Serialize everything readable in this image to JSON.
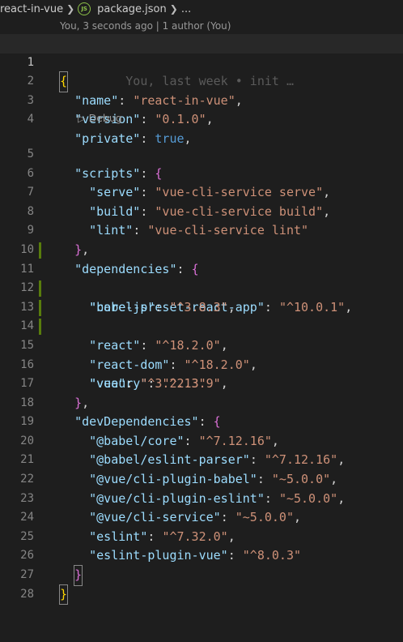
{
  "breadcrumb": {
    "folder": "react-in-vue",
    "file_icon": "JS",
    "file": "package.json",
    "more": "..."
  },
  "codelens": {
    "author": "You, 3 seconds ago | 1 author (You)",
    "debug": "Debug"
  },
  "blame_inline": "You, last week • init …",
  "colors": {
    "background": "#1e1e1e",
    "key": "#9cdcfe",
    "string": "#ce9178",
    "keyword": "#569cd6",
    "brace_level0": "#ffd700",
    "brace_level1": "#da70d6",
    "added_line_marker": "#587c0c"
  },
  "lines": [
    {
      "n": "1"
    },
    {
      "n": "2"
    },
    {
      "n": "3"
    },
    {
      "n": "4"
    },
    {
      "n": "5"
    },
    {
      "n": "6"
    },
    {
      "n": "7"
    },
    {
      "n": "8"
    },
    {
      "n": "9"
    },
    {
      "n": "10"
    },
    {
      "n": "11"
    },
    {
      "n": "12"
    },
    {
      "n": "13"
    },
    {
      "n": "14"
    },
    {
      "n": "15"
    },
    {
      "n": "16"
    },
    {
      "n": "17"
    },
    {
      "n": "18"
    },
    {
      "n": "19"
    },
    {
      "n": "20"
    },
    {
      "n": "21"
    },
    {
      "n": "22"
    },
    {
      "n": "23"
    },
    {
      "n": "24"
    },
    {
      "n": "25"
    },
    {
      "n": "26"
    },
    {
      "n": "27"
    },
    {
      "n": "28"
    }
  ],
  "json": {
    "name_key": "\"name\"",
    "name_val": "\"react-in-vue\"",
    "version_key": "\"version\"",
    "version_val": "\"0.1.0\"",
    "private_key": "\"private\"",
    "private_val": "true",
    "scripts_key": "\"scripts\"",
    "serve_key": "\"serve\"",
    "serve_val": "\"vue-cli-service serve\"",
    "build_key": "\"build\"",
    "build_val": "\"vue-cli-service build\"",
    "lint_key": "\"lint\"",
    "lint_val": "\"vue-cli-service lint\"",
    "deps_key": "\"dependencies\"",
    "dep1_key": "\"babel-preset-react-app\"",
    "dep1_val": "\"^10.0.1\"",
    "dep2_key": "\"core-js\"",
    "dep2_val": "\"^3.8.3\"",
    "dep3_key": "\"react\"",
    "dep3_val": "\"^18.2.0\"",
    "dep4_key": "\"react-dom\"",
    "dep4_val": "\"^18.2.0\"",
    "dep5_key": "\"veaury\"",
    "dep5_val": "\"^2.3.9\"",
    "dep6_key": "\"vue\"",
    "dep6_val": "\"^3.2.13\"",
    "devdeps_key": "\"devDependencies\"",
    "dev1_key": "\"@babel/core\"",
    "dev1_val": "\"^7.12.16\"",
    "dev2_key": "\"@babel/eslint-parser\"",
    "dev2_val": "\"^7.12.16\"",
    "dev3_key": "\"@vue/cli-plugin-babel\"",
    "dev3_val": "\"~5.0.0\"",
    "dev4_key": "\"@vue/cli-plugin-eslint\"",
    "dev4_val": "\"~5.0.0\"",
    "dev5_key": "\"@vue/cli-service\"",
    "dev5_val": "\"~5.0.0\"",
    "dev6_key": "\"eslint\"",
    "dev6_val": "\"^7.32.0\"",
    "dev7_key": "\"eslint-plugin-vue\"",
    "dev7_val": "\"^8.0.3\""
  }
}
